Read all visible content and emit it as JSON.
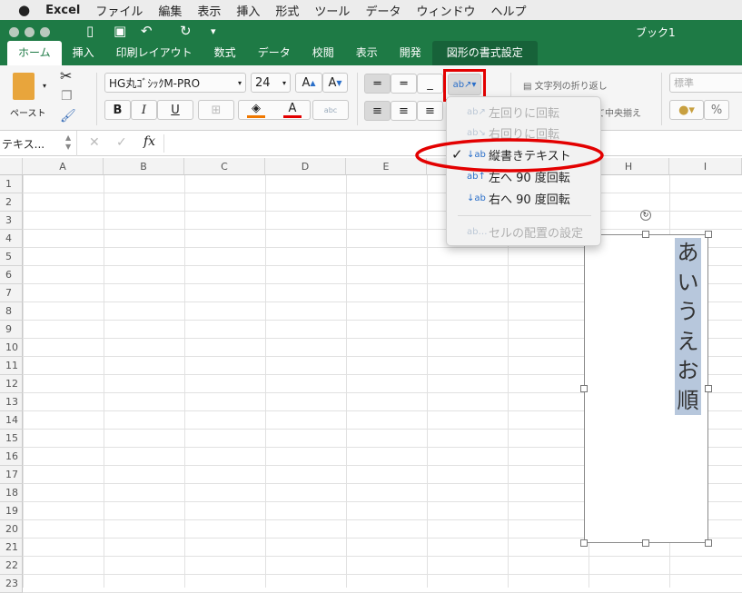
{
  "menubar": {
    "app": "Excel",
    "items": [
      "ファイル",
      "編集",
      "表示",
      "挿入",
      "形式",
      "ツール",
      "データ",
      "ウィンドウ",
      "ヘルプ"
    ]
  },
  "window": {
    "title": "ブック1"
  },
  "tabs": [
    "ホーム",
    "挿入",
    "印刷レイアウト",
    "数式",
    "データ",
    "校閲",
    "表示",
    "開発"
  ],
  "context_tab": "図形の書式設定",
  "ribbon": {
    "paste": "ペースト",
    "font": "HG丸ｺﾞｼｯｸM-PRO",
    "size": "24",
    "bold": "B",
    "italic": "I",
    "underline": "U",
    "grow": "A",
    "shrink": "A",
    "fontcolor": "A",
    "phonetic": "abc",
    "wrap": "文字列の折り返し",
    "merge": "て中央揃え",
    "numfmt": "標準",
    "percent": "%"
  },
  "formula": {
    "namebox": "テキス...",
    "fx": "fx",
    "cancel": "✕",
    "enter": "✓"
  },
  "columns": [
    "A",
    "B",
    "C",
    "D",
    "E",
    "F",
    "G",
    "H",
    "I"
  ],
  "rows": [
    "1",
    "2",
    "3",
    "4",
    "5",
    "6",
    "7",
    "8",
    "9",
    "10",
    "11",
    "12",
    "13",
    "14",
    "15",
    "16",
    "17",
    "18",
    "19",
    "20",
    "21",
    "22",
    "23"
  ],
  "shape_text": "あいうえお順",
  "orientation_menu": {
    "items": [
      {
        "label": "左回りに回転",
        "icon": "ab↗",
        "enabled": false,
        "checked": false
      },
      {
        "label": "右回りに回転",
        "icon": "ab↘",
        "enabled": false,
        "checked": false
      },
      {
        "label": "縦書きテキスト",
        "icon": "↓ab",
        "enabled": true,
        "checked": true
      },
      {
        "label": "左へ 90 度回転",
        "icon": "ab↑",
        "enabled": true,
        "checked": false
      },
      {
        "label": "右へ 90 度回転",
        "icon": "↓ab",
        "enabled": true,
        "checked": false
      }
    ],
    "settings": "セルの配置の設定",
    "check": "✓"
  },
  "colors": {
    "accent": "#1e7a45",
    "highlight": "#e30000",
    "fill": "#f07800",
    "fontcolor": "#e30000"
  }
}
